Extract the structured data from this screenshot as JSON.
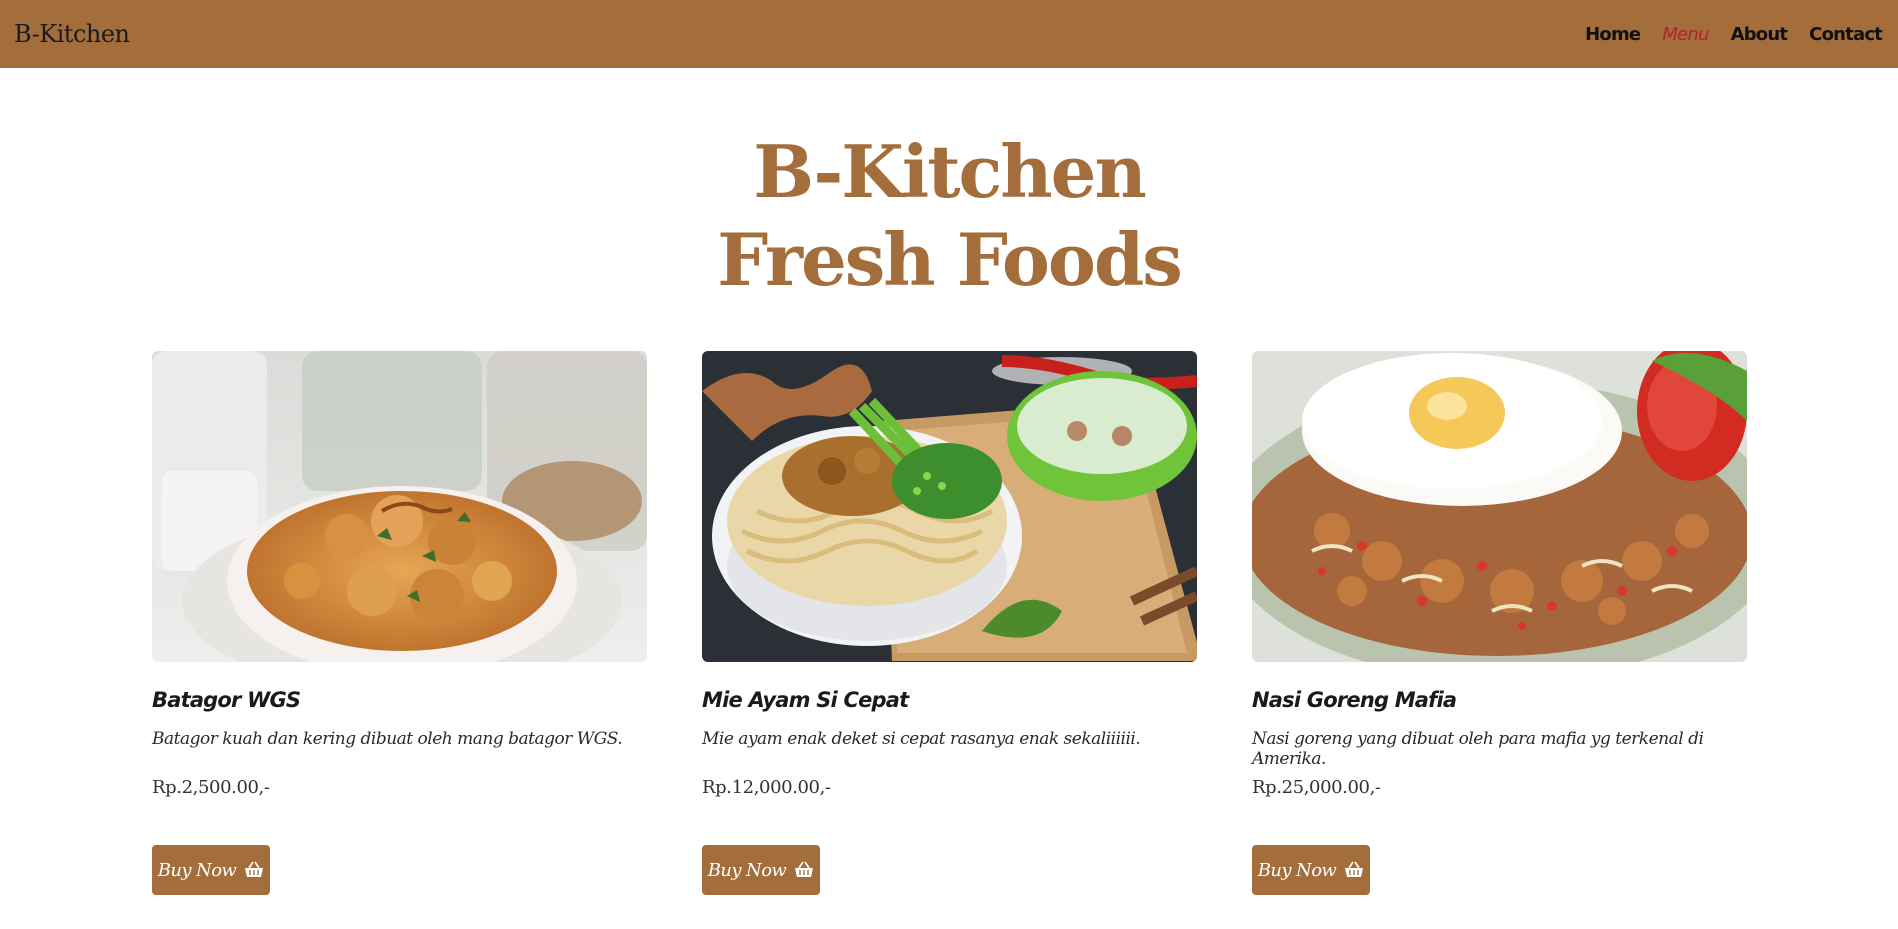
{
  "navbar": {
    "brand": "B-Kitchen",
    "links": [
      {
        "label": "Home",
        "active": false
      },
      {
        "label": "Menu",
        "active": true
      },
      {
        "label": "About",
        "active": false
      },
      {
        "label": "Contact",
        "active": false
      }
    ]
  },
  "hero": {
    "line1": "B-Kitchen",
    "line2": "Fresh Foods"
  },
  "products": [
    {
      "title": "Batagor WGS",
      "description": "Batagor kuah dan kering dibuat oleh mang batagor WGS.",
      "price": "Rp.2,500.00,-",
      "button_label": "Buy Now",
      "button_icon": "basket-icon"
    },
    {
      "title": "Mie Ayam Si Cepat",
      "description": "Mie ayam enak deket si cepat rasanya enak sekaliiiiii.",
      "price": "Rp.12,000.00,-",
      "button_label": "Buy Now",
      "button_icon": "basket-icon"
    },
    {
      "title": "Nasi Goreng Mafia",
      "description": "Nasi goreng yang dibuat oleh para mafia yg terkenal di Amerika.",
      "price": "Rp.25,000.00,-",
      "button_label": "Buy Now",
      "button_icon": "basket-icon"
    }
  ],
  "colors": {
    "brand": "#a46e3c",
    "active_link": "#b3222e",
    "button_text": "#ffffff"
  }
}
